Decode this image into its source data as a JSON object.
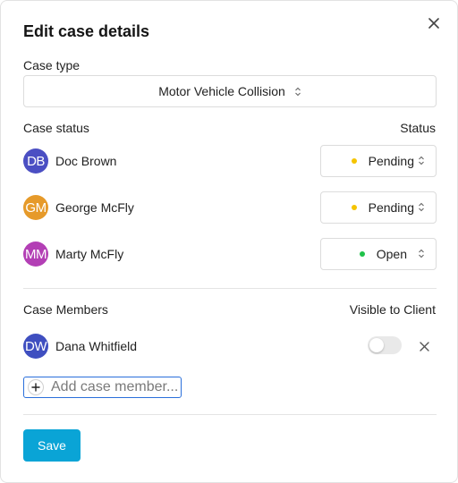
{
  "dialog": {
    "title": "Edit case details",
    "close_icon": "close-icon"
  },
  "case_type": {
    "label": "Case type",
    "value": "Motor Vehicle Collision"
  },
  "case_status": {
    "section_label": "Case status",
    "column_label": "Status",
    "rows": [
      {
        "initials": "DB",
        "name": "Doc Brown",
        "status": "Pending",
        "avatar_color": "#4b4fc3",
        "dot_color": "#f5c400"
      },
      {
        "initials": "GM",
        "name": "George McFly",
        "status": "Pending",
        "avatar_color": "#e69a2a",
        "dot_color": "#f5c400"
      },
      {
        "initials": "MM",
        "name": "Marty McFly",
        "status": "Open",
        "avatar_color": "#b33fb5",
        "dot_color": "#1fc24a"
      }
    ]
  },
  "case_members": {
    "section_label": "Case Members",
    "column_label": "Visible to Client",
    "members": [
      {
        "initials": "DW",
        "name": "Dana Whitfield",
        "avatar_color": "#3f4fc0",
        "visible_to_client": false
      }
    ],
    "add_placeholder": "Add case member..."
  },
  "actions": {
    "save_label": "Save",
    "save_color": "#0aa4d6"
  }
}
